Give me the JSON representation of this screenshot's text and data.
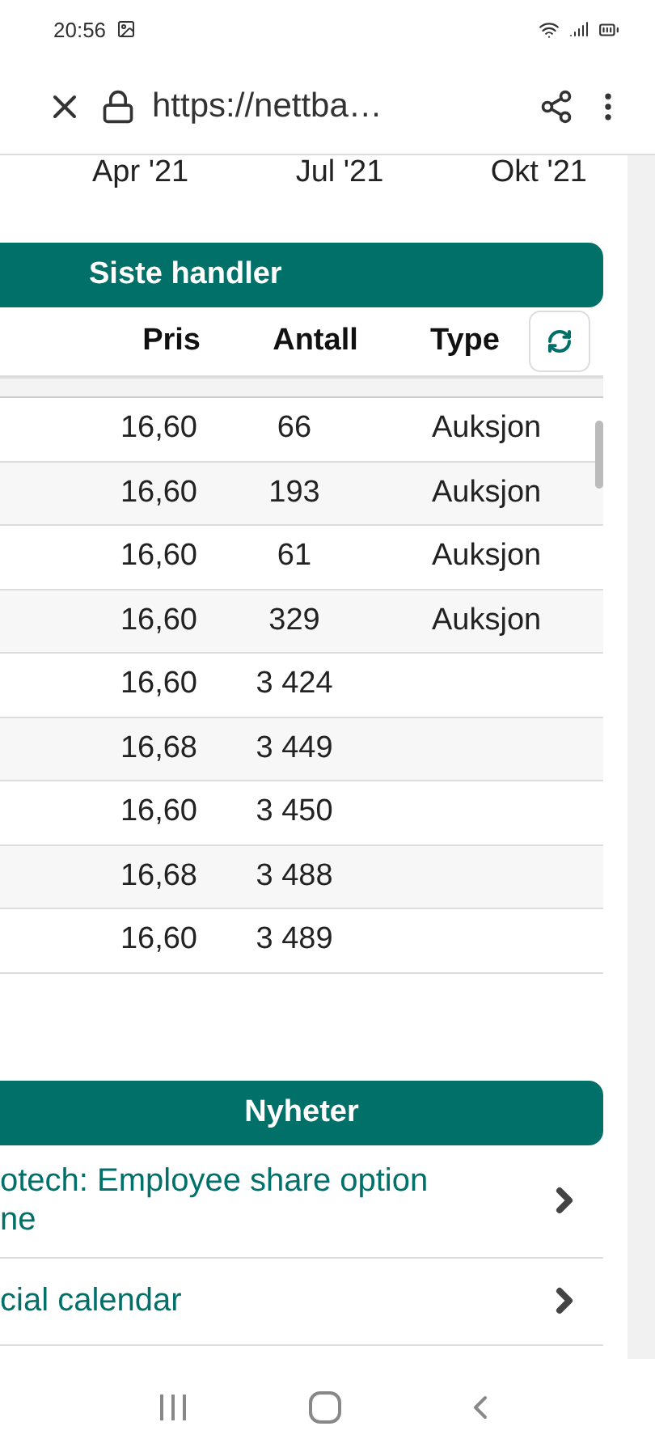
{
  "status_bar": {
    "time": "20:56"
  },
  "browser_bar": {
    "url": "https://nettba…"
  },
  "chart_axis": {
    "labels": [
      "Apr '21",
      "Jul '21",
      "Okt '21"
    ]
  },
  "trades": {
    "title": "Siste handler",
    "columns": [
      "Pris",
      "Antall",
      "Type"
    ],
    "rows": [
      {
        "price": "16,60",
        "quantity": "66",
        "type": "Auksjon"
      },
      {
        "price": "16,60",
        "quantity": "193",
        "type": "Auksjon"
      },
      {
        "price": "16,60",
        "quantity": "61",
        "type": "Auksjon"
      },
      {
        "price": "16,60",
        "quantity": "329",
        "type": "Auksjon"
      },
      {
        "price": "16,60",
        "quantity": "3 424"
      },
      {
        "price": "16,68",
        "quantity": "3 449"
      },
      {
        "price": "16,60",
        "quantity": "3 450"
      },
      {
        "price": "16,68",
        "quantity": "3 488"
      },
      {
        "price": "16,60",
        "quantity": "3 489"
      }
    ]
  },
  "news": {
    "title": "Nyheter",
    "items": [
      {
        "lines": [
          "otech: Employee share option",
          "ne"
        ]
      },
      {
        "lines": [
          "cial calendar"
        ]
      }
    ]
  }
}
